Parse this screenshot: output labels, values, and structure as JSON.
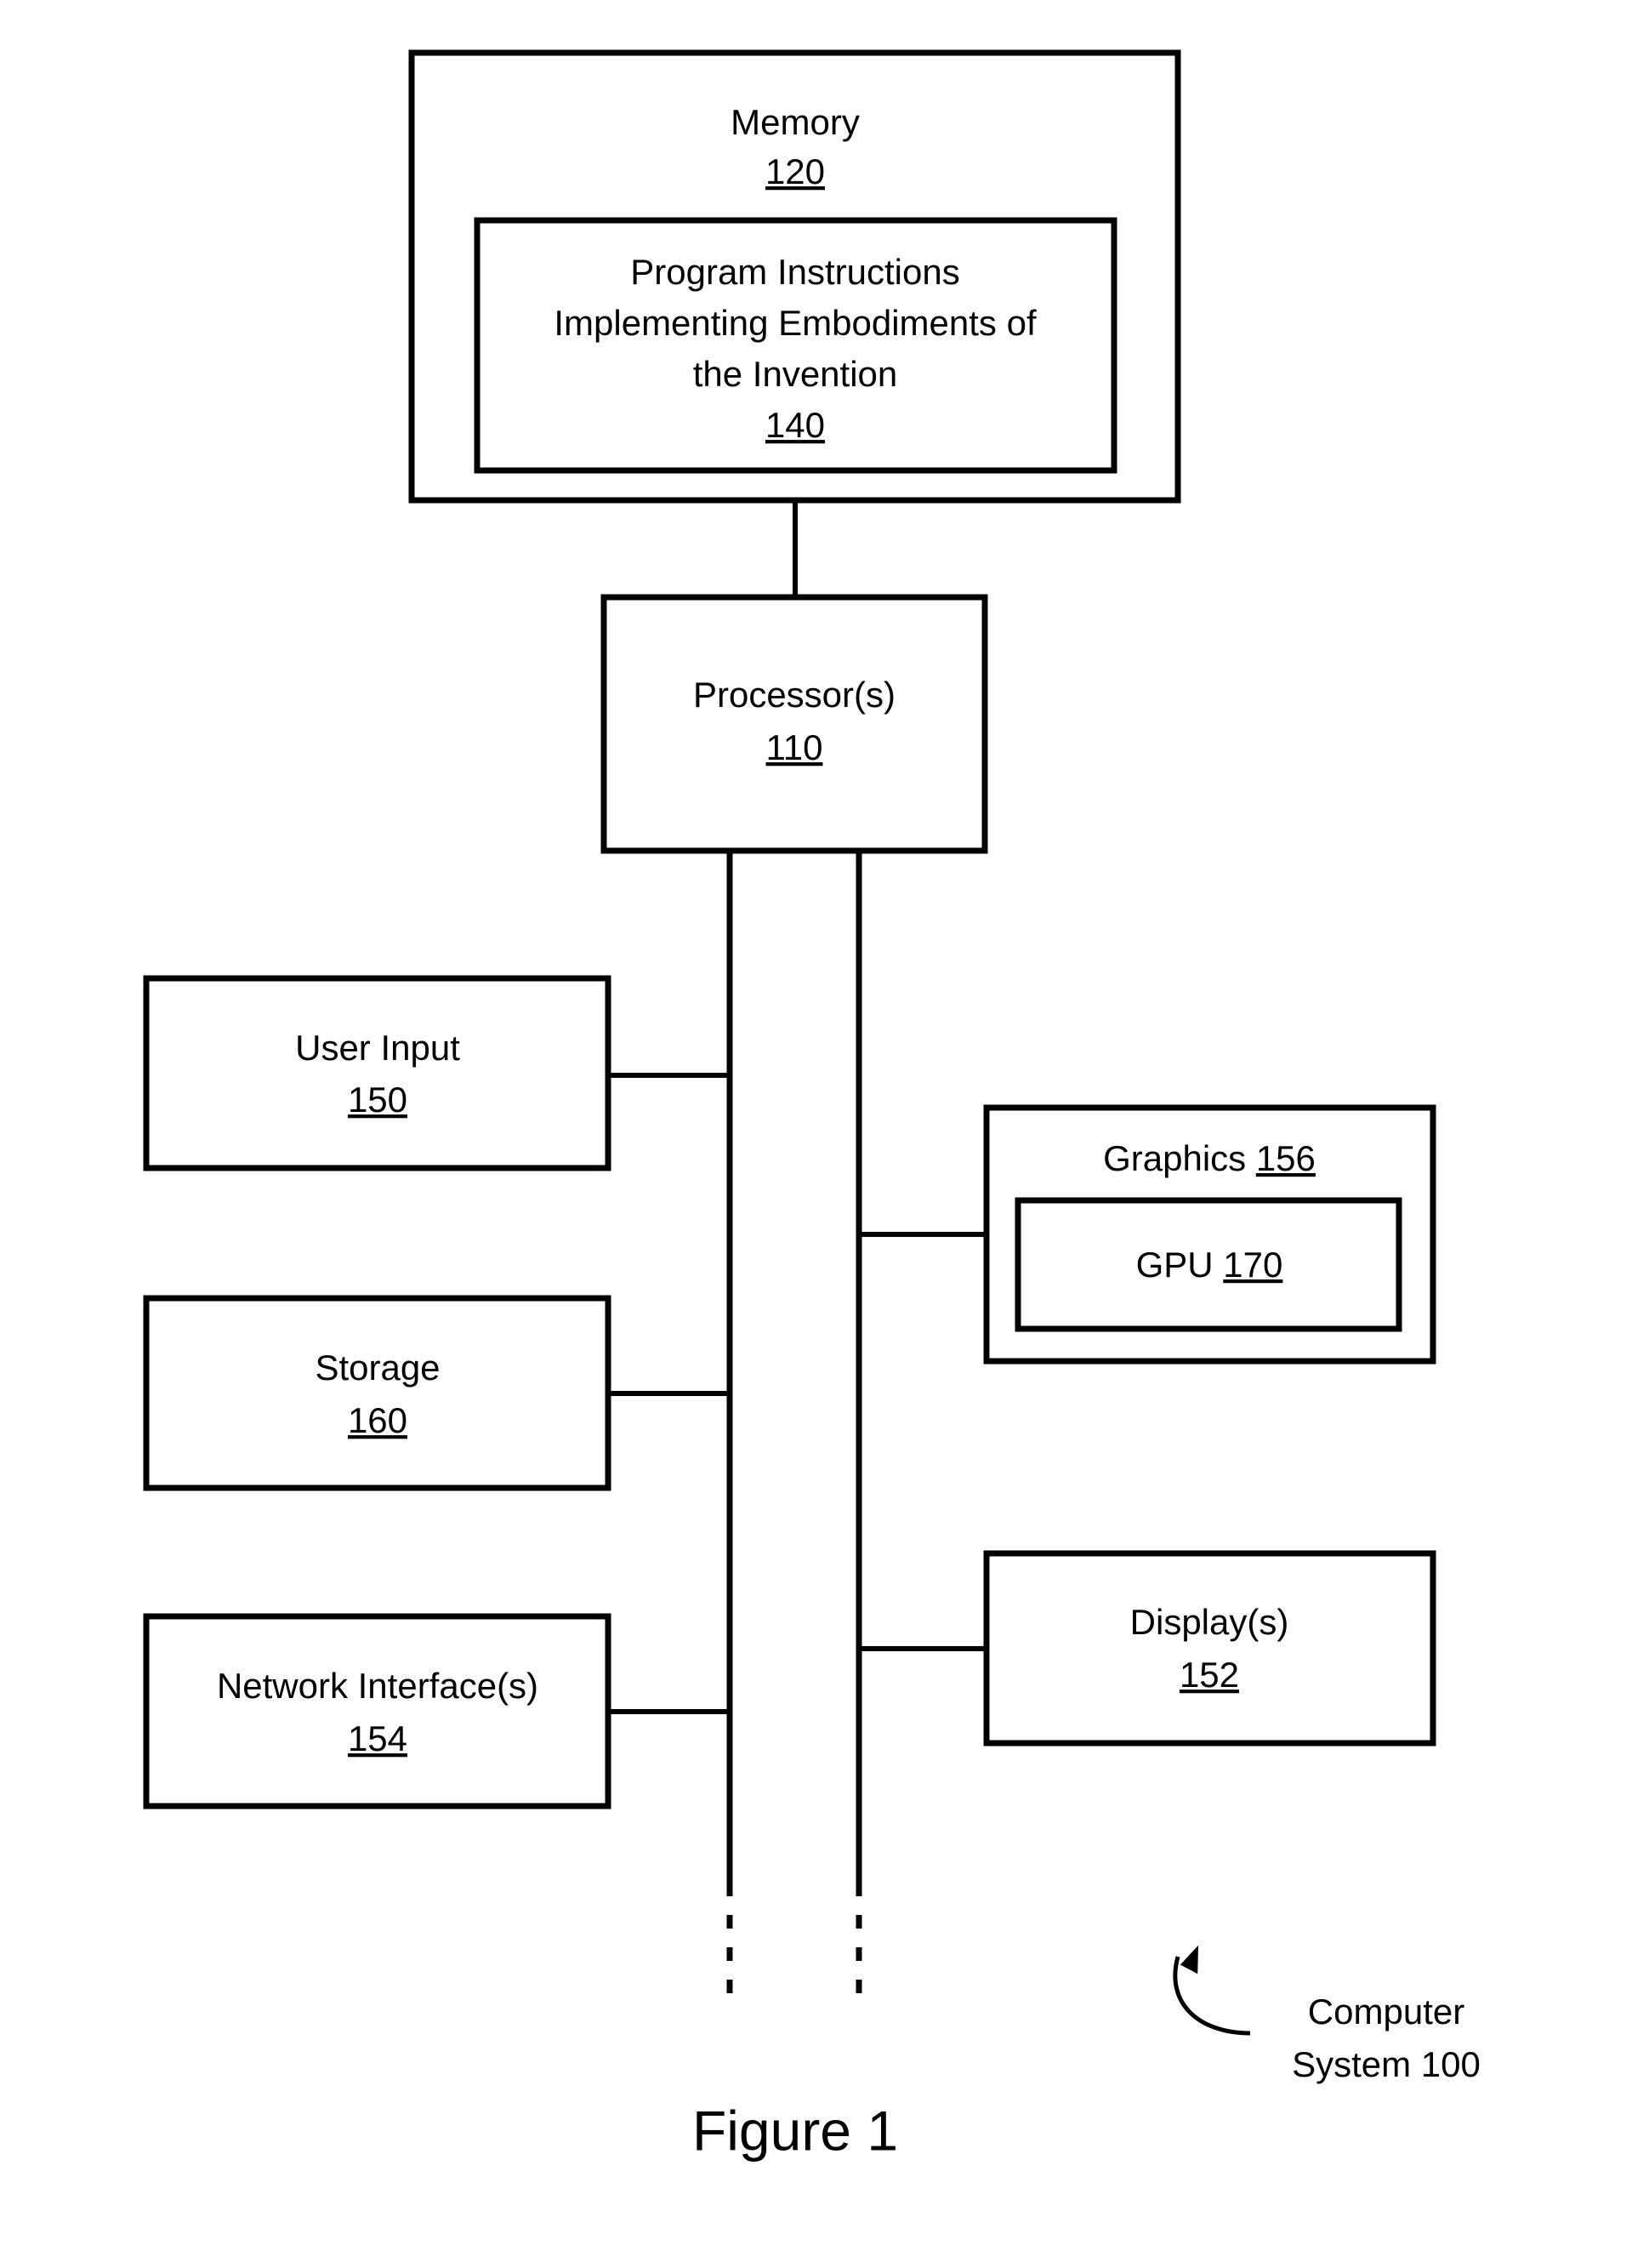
{
  "figure": {
    "caption": "Figure 1",
    "callout": {
      "line1": "Computer",
      "line2": "System 100"
    }
  },
  "blocks": {
    "memory": {
      "label": "Memory",
      "ref": "120"
    },
    "program_instructions": {
      "line1": "Program Instructions",
      "line2": "Implementing Embodiments of",
      "line3": "the Invention",
      "ref": "140"
    },
    "processor": {
      "label": "Processor(s)",
      "ref": "110"
    },
    "user_input": {
      "label": "User Input",
      "ref": "150"
    },
    "storage": {
      "label": "Storage",
      "ref": "160"
    },
    "network_interface": {
      "label": "Network Interface(s)",
      "ref": "154"
    },
    "graphics": {
      "label": "Graphics",
      "ref": "156"
    },
    "gpu": {
      "label": "GPU",
      "ref": "170"
    },
    "display": {
      "label": "Display(s)",
      "ref": "152"
    }
  },
  "colors": {
    "stroke": "#000000",
    "fill": "#ffffff",
    "text": "#000000"
  }
}
